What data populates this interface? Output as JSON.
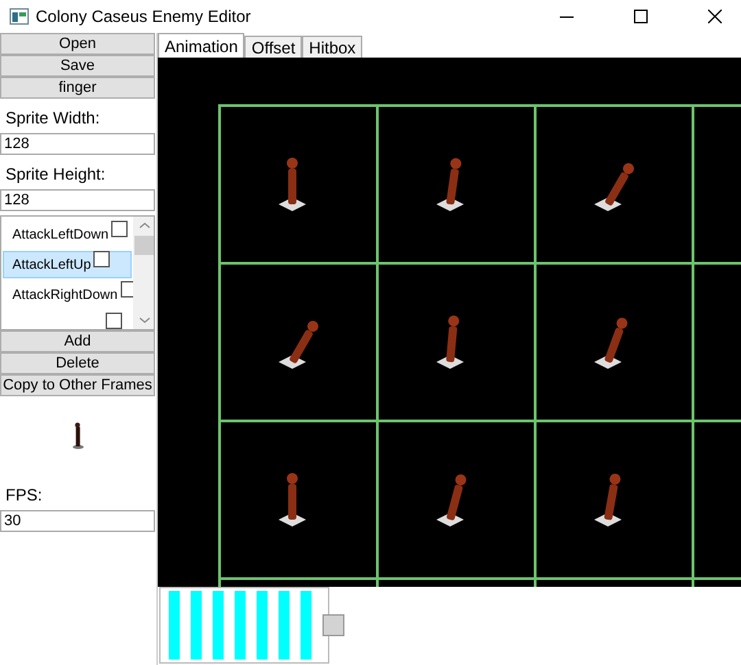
{
  "window": {
    "title": "Colony Caseus Enemy Editor"
  },
  "file_buttons": [
    {
      "label": "Open"
    },
    {
      "label": "Save"
    },
    {
      "label": "finger"
    }
  ],
  "fields": [
    {
      "label": "Sprite Width:",
      "value": "128"
    },
    {
      "label": "Sprite Height:",
      "value": "128"
    }
  ],
  "animations": [
    {
      "label": "AttackLeftDown",
      "checked": false,
      "selected": false
    },
    {
      "label": "AttackLeftUp",
      "checked": false,
      "selected": true
    },
    {
      "label": "AttackRightDown",
      "checked": false,
      "selected": false
    },
    {
      "checked": false,
      "selected": false
    }
  ],
  "list_buttons": [
    {
      "label": "Add"
    },
    {
      "label": "Delete"
    },
    {
      "label": "Copy to Other Frames"
    }
  ],
  "fps": {
    "label": "FPS:",
    "value": "30"
  },
  "tabs": [
    {
      "label": "Animation",
      "selected": true
    },
    {
      "label": "Offset",
      "selected": false
    },
    {
      "label": "Hitbox",
      "selected": false
    }
  ]
}
